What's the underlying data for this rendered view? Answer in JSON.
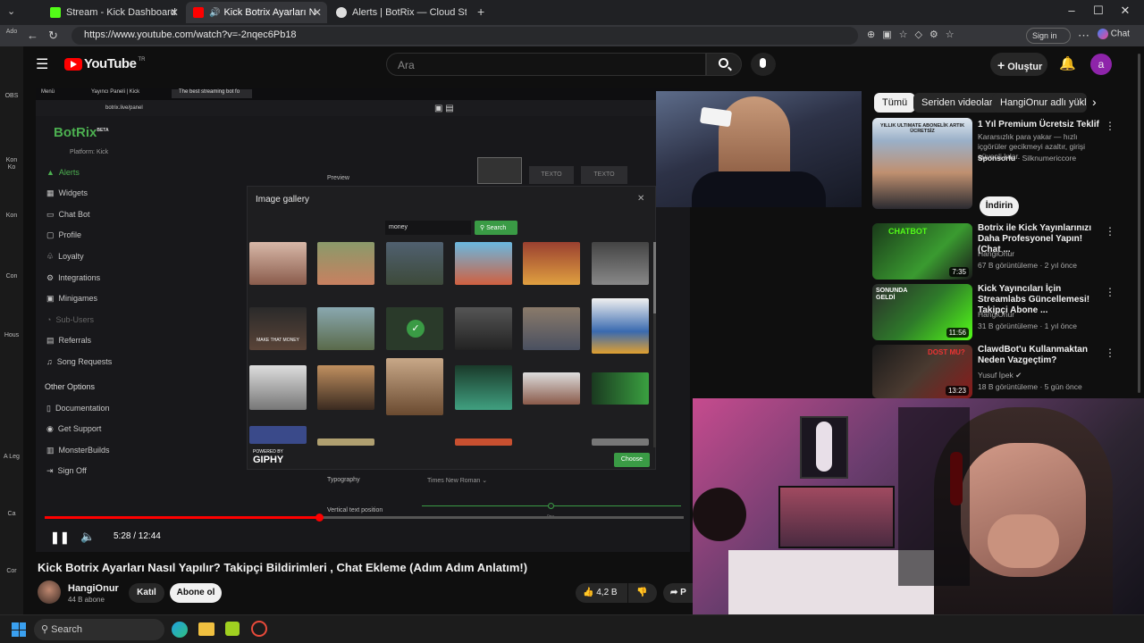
{
  "browser": {
    "tabs": [
      {
        "label": "Stream - Kick Dashboard"
      },
      {
        "label": "Kick Botrix Ayarları Nasıl Yapıl"
      },
      {
        "label": "Alerts | BotRix — Cloud Streaming"
      }
    ],
    "url": "https://www.youtube.com/watch?v=-2nqec6Pb18",
    "sign_in": "Sign in",
    "chat": "Chat"
  },
  "desktop_icons": [
    "Ado",
    "OBS",
    "Kon Ko",
    "Kon",
    "Con",
    "Hous",
    "A Leg",
    "Ca",
    "Cor"
  ],
  "youtube": {
    "logo": "YouTube",
    "logo_region": "TR",
    "search_placeholder": "Ara",
    "create_label": "Oluştur",
    "avatar_letter": "a"
  },
  "video_content": {
    "browser_tabs": [
      "Menü",
      "Yayıncı Paneli | Kick",
      "The best streaming bot fo"
    ],
    "url": "botrix.live/panel",
    "brand": "BotRix",
    "brand_sup": "BETA",
    "platform": "Platform: Kick",
    "sidebar": [
      {
        "label": "Alerts"
      },
      {
        "label": "Widgets"
      },
      {
        "label": "Chat Bot"
      },
      {
        "label": "Profile"
      },
      {
        "label": "Loyalty"
      },
      {
        "label": "Integrations"
      },
      {
        "label": "Minigames"
      },
      {
        "label": "Sub-Users"
      },
      {
        "label": "Referrals"
      },
      {
        "label": "Song Requests"
      }
    ],
    "other_options": "Other Options",
    "other_items": [
      {
        "label": "Documentation"
      },
      {
        "label": "Get Support"
      },
      {
        "label": "MonsterBuilds"
      },
      {
        "label": "Sign Off"
      }
    ],
    "modal_title": "Image gallery",
    "modal_search_value": "money",
    "modal_search_button": "Search",
    "powered_by": "POWERED BY",
    "giphy": "GIPHY",
    "choose": "Choose",
    "preview_label": "Preview",
    "texto": "TEXTO",
    "typography": "Typography",
    "font_value": "Times New Roman",
    "vertical_pos": "Vertical text position",
    "slider_value": "0px",
    "make_that_money": "MAKE THAT MONEY"
  },
  "player": {
    "time": "5:28 / 12:44",
    "progress": 0.43
  },
  "video_title": "Kick Botrix Ayarları Nasıl Yapılır? Takipçi Bildirimleri , Chat Ekleme (Adım Adım Anlatım!)",
  "channel": {
    "name": "HangiOnur",
    "subs": "44 B abone",
    "join": "Katıl",
    "subscribe": "Abone ol",
    "likes": "4,2 B",
    "share": "P"
  },
  "chips": [
    "Tümü",
    "Seriden videolar",
    "HangiOnur adlı yükle"
  ],
  "recommendations": [
    {
      "title": "1 Yıl Premium Ücretsiz Teklif",
      "desc": "Kararsızlık para yakar — hızlı içgörüler gecikmeyi azaltır, girişi güvenli kılar.",
      "channel": "Sponsorlu",
      "extra": "· Silknumericcore",
      "button": "İndirin",
      "thumb_text": "YILLIK ULTIMATE ABONELİK ARTIK ÜCRETSİZ"
    },
    {
      "title": "Botrix ile Kick Yayınlarınızı Daha Profesyonel Yapın! (Chat ...",
      "channel": "HangiOnur",
      "meta": "67 B görüntüleme · 2 yıl önce",
      "duration": "7:35",
      "thumb_text": "CHATBOT"
    },
    {
      "title": "Kick Yayıncıları İçin Streamlabs Güncellemesi! Takipçi Abone ...",
      "channel": "HangiOnur",
      "meta": "31 B görüntüleme · 1 yıl önce",
      "duration": "11:56",
      "thumb_text": "SONUNDA GELDİ"
    },
    {
      "title": "ClawdBot'u Kullanmaktan Neden Vazgeçtim?",
      "channel": "Yusuf İpek",
      "meta": "18 B görüntüleme · 5 gün önce",
      "duration": "13:23",
      "thumb_text": "DOST MU?"
    }
  ],
  "taskbar": {
    "search": "Search"
  },
  "colors": {
    "accent_red": "#ff0000",
    "botrix_green": "#4caf50",
    "kick_green": "#53fc18"
  }
}
